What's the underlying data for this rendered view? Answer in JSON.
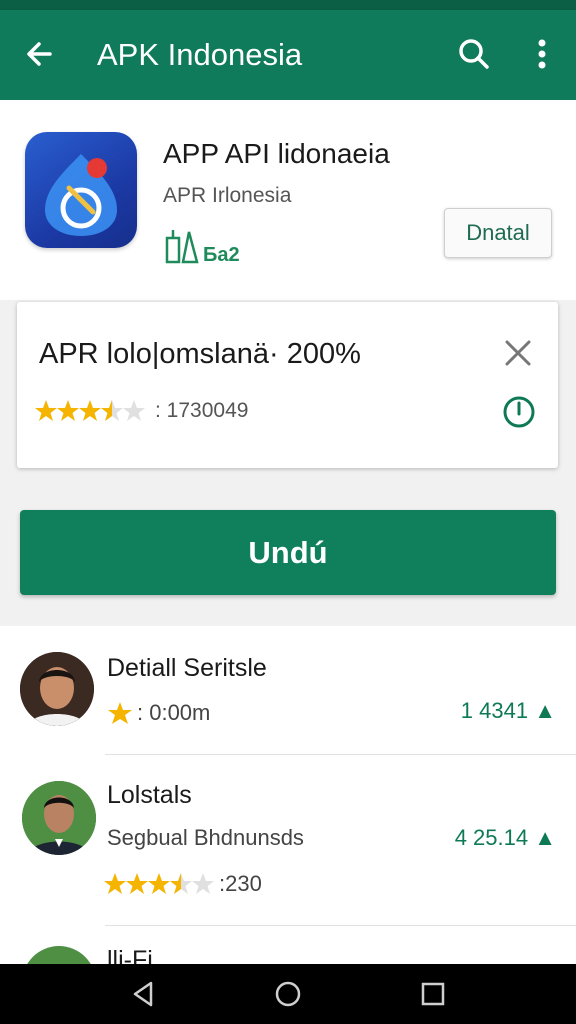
{
  "appbar": {
    "title": "APK Indonesia",
    "icons": [
      "back-arrow-icon",
      "search-icon",
      "more-vert-icon"
    ]
  },
  "app": {
    "title": "APP API lidonaeia",
    "developer": "APR Irlonesia",
    "badge_text": "Бa2",
    "install_label": "Dnatal",
    "icon": "app-logo-icon"
  },
  "progress": {
    "title": "APR lolo|omslanä· 200%",
    "rating_text": ": 1730049",
    "stars": 3.5,
    "icons": [
      "close-icon",
      "clock-icon"
    ]
  },
  "download": {
    "label": "Undú"
  },
  "list": [
    {
      "name": "Detiall Seritsle",
      "meta": ": 0:00m",
      "size": "1 4341",
      "stars": 1
    },
    {
      "name": "Lolstals",
      "subtitle": "Segbual Bhdnunsds",
      "meta": ":230",
      "size": "4 25.14",
      "stars": 3.5
    },
    {
      "name": "lli-Fi"
    }
  ],
  "colors": {
    "primary": "#0f7b5a",
    "status_bar": "#0b5f45",
    "accent_text": "#0e7a55",
    "star": "#f4b400"
  }
}
